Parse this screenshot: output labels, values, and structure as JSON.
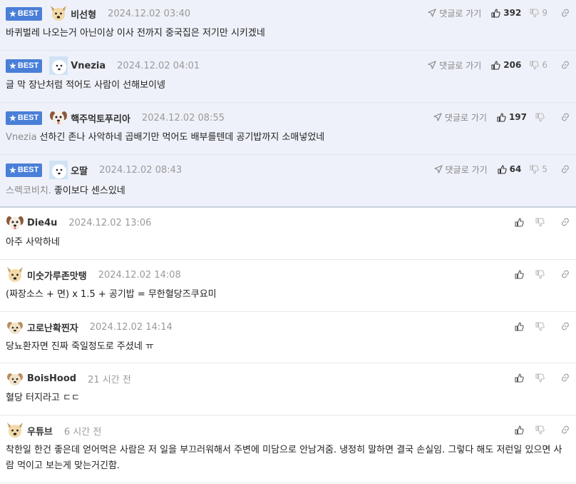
{
  "labels": {
    "best": "BEST",
    "goto_comment": "댓글로 가기"
  },
  "colors": {
    "best_badge": "#4a7fd8",
    "best_bg": "#eef1f9"
  },
  "comments": [
    {
      "best": true,
      "avatar": "dog-face-avatar",
      "nickname": "비선형",
      "date": "2024.12.02 03:40",
      "mention": "",
      "text": "바퀴벌레 나오는거 아닌이상 이사 전까지 중국집은 저기만 시키겠네",
      "likes": "392",
      "dislikes": "9"
    },
    {
      "best": true,
      "avatar": "white-dog-avatar",
      "nickname": "Vnezia",
      "date": "2024.12.02 04:01",
      "mention": "",
      "text": "글 막 장난처럼 적어도 사람이 선해보이넹",
      "likes": "206",
      "dislikes": "6"
    },
    {
      "best": true,
      "avatar": "puppy-face-avatar",
      "nickname": "핵주먹토푸리아",
      "date": "2024.12.02 08:55",
      "mention": "Vnezia",
      "text": "선하긴 존나 사악하네 곱배기만 먹어도 배부를텐데 공기밥까지 소매넣었네",
      "likes": "197",
      "dislikes": ""
    },
    {
      "best": true,
      "avatar": "white-dog-avatar",
      "nickname": "오딸",
      "date": "2024.12.02 08:43",
      "mention": "스렉코비치.",
      "text": "좋이보다 센스있네",
      "likes": "64",
      "dislikes": "5"
    },
    {
      "best": false,
      "avatar": "puppy-face-avatar",
      "nickname": "Die4u",
      "date": "2024.12.02 13:06",
      "mention": "",
      "text": "아주 사악하네",
      "likes": "",
      "dislikes": ""
    },
    {
      "best": false,
      "avatar": "dog-face-avatar",
      "nickname": "미숫가루존맛탱",
      "date": "2024.12.02 14:08",
      "mention": "",
      "text": "(짜장소스 + 면) x 1.5 + 공기밥 = 무한혈당즈쿠요미",
      "likes": "",
      "dislikes": ""
    },
    {
      "best": false,
      "avatar": "small-dog-avatar",
      "nickname": "고로난확찐자",
      "date": "2024.12.02 14:14",
      "mention": "",
      "text": "당뇨환자면 진짜 죽일정도로 주셨네 ㅠ",
      "likes": "",
      "dislikes": ""
    },
    {
      "best": false,
      "avatar": "small-dog-avatar",
      "nickname": "BoisHood",
      "date": "21 시간 전",
      "mention": "",
      "text": "혈당 터지라고 ㄷㄷ",
      "likes": "",
      "dislikes": ""
    },
    {
      "best": false,
      "avatar": "dog-face-avatar",
      "nickname": "우튜브",
      "date": "6 시간 전",
      "mention": "",
      "text": "착한일 한건 좋은데 얻어먹은 사람은 저 일을 부끄러워해서 주변에 미담으로 안남겨줌. 냉정히 말하면 결국 손실임. 그렇다 해도 저런일 있으면 사람 먹이고 보는게 맞는거긴함.",
      "likes": "",
      "dislikes": ""
    }
  ]
}
